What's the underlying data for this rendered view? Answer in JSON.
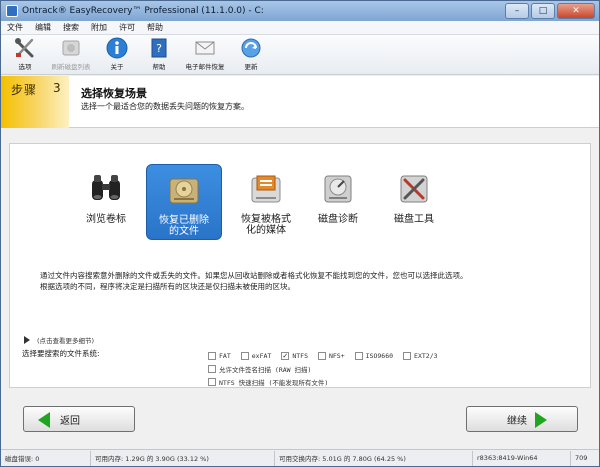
{
  "window": {
    "title": "Ontrack® EasyRecovery™ Professional (11.1.0.0) - C:",
    "min_label": "–",
    "max_label": "□",
    "close_label": "✕"
  },
  "menu": [
    "文件",
    "编辑",
    "搜索",
    "附加",
    "许可",
    "帮助"
  ],
  "toolbar": {
    "items": [
      {
        "label": "选项",
        "icon": "tools-icon",
        "enabled": true
      },
      {
        "label": "刷新磁盘列表",
        "icon": "disk-icon",
        "enabled": false
      },
      {
        "label": "关于",
        "icon": "info-icon",
        "enabled": true
      },
      {
        "label": "帮助",
        "icon": "help-book-icon",
        "enabled": true
      },
      {
        "label": "电子邮件恢复",
        "icon": "envelope-icon",
        "enabled": true
      },
      {
        "label": "更新",
        "icon": "update-globe-icon",
        "enabled": true
      }
    ]
  },
  "step": {
    "label": "步骤",
    "number": "3",
    "title": "选择恢复场景",
    "subtitle": "选择一个最适合您的数据丢失问题的恢复方案。"
  },
  "scenarios": [
    {
      "label_line1": "浏览卷标",
      "label_line2": "",
      "icon": "binoculars-icon",
      "selected": false
    },
    {
      "label_line1": "恢复已删除",
      "label_line2": "的文件",
      "icon": "deleted-files-drive-icon",
      "selected": true
    },
    {
      "label_line1": "恢复被格式",
      "label_line2": "化的媒体",
      "icon": "formatted-media-drive-icon",
      "selected": false
    },
    {
      "label_line1": "磁盘诊断",
      "label_line2": "",
      "icon": "disk-diagnostics-icon",
      "selected": false
    },
    {
      "label_line1": "磁盘工具",
      "label_line2": "",
      "icon": "disk-tools-icon",
      "selected": false
    }
  ],
  "description": {
    "line1": "通过文件内容搜索意外删除的文件或丢失的文件。如果您从回收站删除或者格式化恢复不能找到您的文件，您也可以选择此选项。",
    "line2": "根据选项的不同，程序将决定是扫描所有的区块还是仅扫描未被使用的区块。"
  },
  "more_details": "(点击查看更多细节)",
  "filesystems": {
    "label": "选择要搜索的文件系统:",
    "options": [
      {
        "label": "FAT",
        "checked": false
      },
      {
        "label": "exFAT",
        "checked": false
      },
      {
        "label": "NTFS",
        "checked": true
      },
      {
        "label": "NFS+",
        "checked": false
      },
      {
        "label": "ISO9660",
        "checked": false
      },
      {
        "label": "EXT2/3",
        "checked": false
      }
    ],
    "signature_scan": "允许文件签名扫描 (RAW 扫描)",
    "ntfs_quick_scan": "NTFS 快速扫描 (不能发现所有文件)",
    "check_mark": "✓"
  },
  "buttons": {
    "back": "返回",
    "next": "继续"
  },
  "statusbar": {
    "disk_errors": "磁盘错误: 0",
    "memory": "可用内存: 1.29G 的 3.90G (33.12 %)",
    "swap": "可用交换内存: 5.01G 的 7.80G (64.25 %)",
    "build": "r8363:8419-Win64",
    "code": "709"
  },
  "colors": {
    "accent_selected": "#2a74c8",
    "step_badge": "#f5c000",
    "arrow_green": "#1fa61f"
  }
}
